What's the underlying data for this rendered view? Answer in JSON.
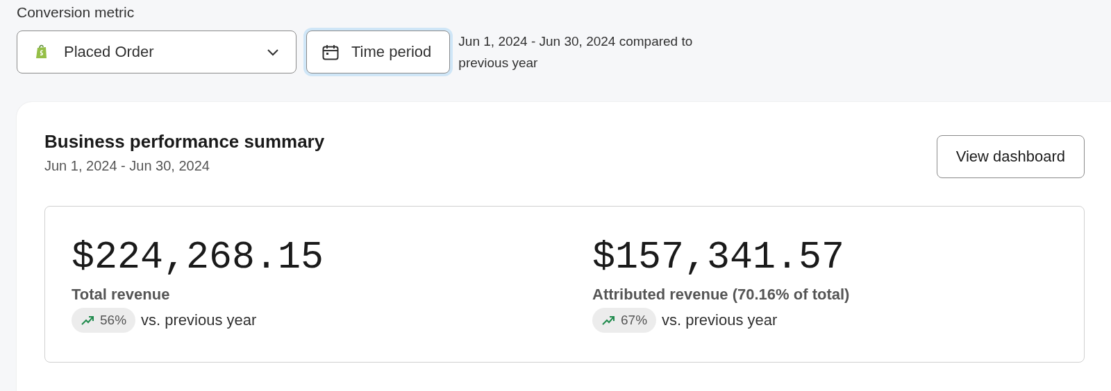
{
  "filters": {
    "metric_label": "Conversion metric",
    "metric_select": {
      "value": "Placed Order"
    },
    "time_button": {
      "label": "Time period",
      "focused": true
    },
    "period_note": "Jun 1, 2024 - Jun 30, 2024 compared to previous year"
  },
  "summary": {
    "title": "Business performance summary",
    "subtitle": "Jun 1, 2024 - Jun 30, 2024",
    "button": "View dashboard",
    "metrics": [
      {
        "value": "$224,268.15",
        "label": "Total revenue",
        "trend": {
          "kind": "up",
          "change": "56%",
          "comparison": "vs. previous year"
        }
      },
      {
        "value": "$157,341.57",
        "label": "Attributed revenue (70.16% of total)",
        "trend": {
          "kind": "up",
          "change": "67%",
          "comparison": "vs. previous year"
        }
      }
    ]
  }
}
